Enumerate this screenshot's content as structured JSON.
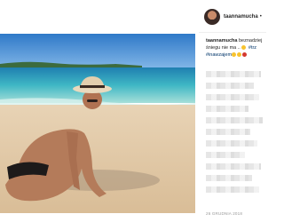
{
  "post": {
    "username": "taannamucha",
    "header_separator": "•",
    "caption_user": "taannamucha",
    "caption_text_1": "beznadziej",
    "caption_text_2": "śniegu nie ma .. ",
    "caption_hashtag_1": "#trz",
    "caption_hashtag_2": "#inawzajem",
    "date": "26 GRUDNIA 2018"
  },
  "colors": {
    "text": "#262626",
    "hashtag": "#003569",
    "muted": "#999999"
  },
  "icons": {
    "avatar": "profile-avatar",
    "emoji": "emoji-face"
  }
}
